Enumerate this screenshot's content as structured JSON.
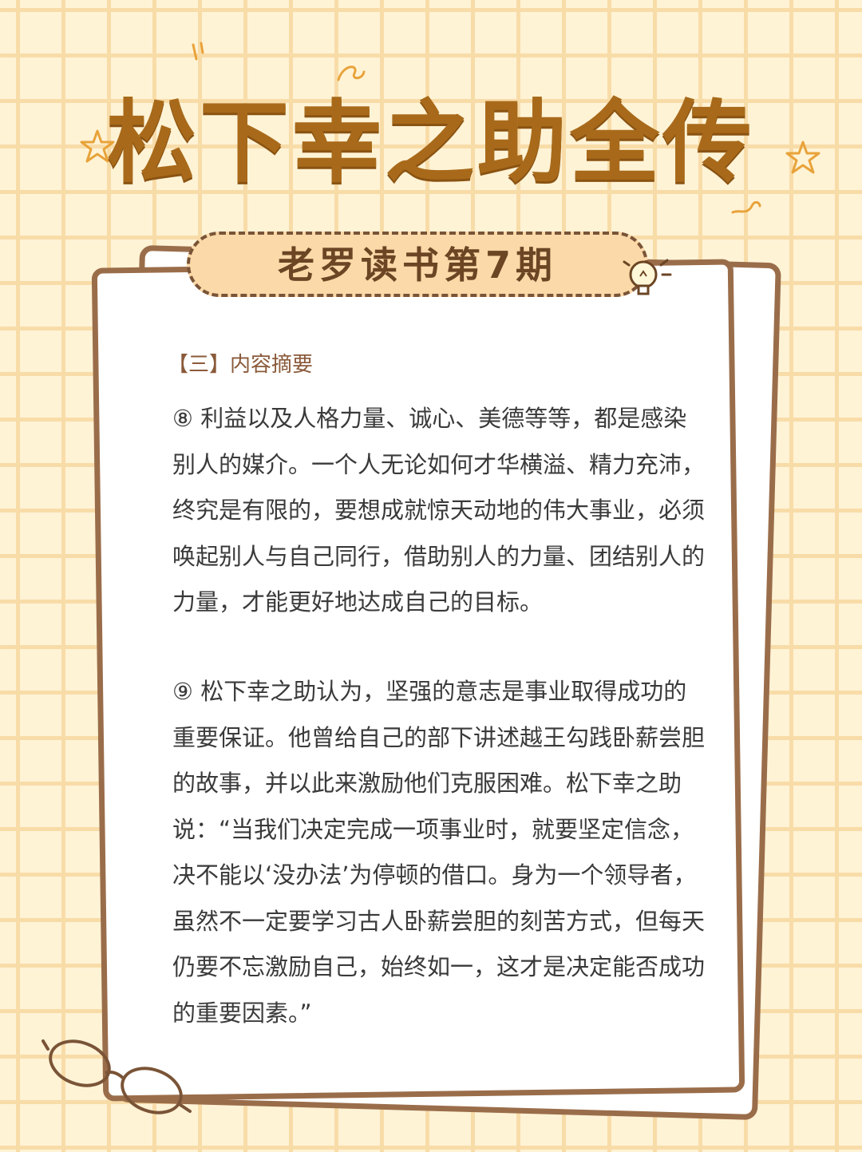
{
  "header": {
    "title": "松下幸之助全传",
    "subtitle": "老罗读书第7期"
  },
  "content": {
    "section_title": "【三】内容摘要",
    "paragraphs": [
      "⑧ 利益以及人格力量、诚心、美德等等，都是感染别人的媒介。一个人无论如何才华横溢、精力充沛，终究是有限的，要想成就惊天动地的伟大事业，必须唤起别人与自己同行，借助别人的力量、团结别人的力量，才能更好地达成自己的目标。",
      "⑨ 松下幸之助认为，坚强的意志是事业取得成功的重要保证。他曾给自己的部下讲述越王勾践卧薪尝胆的故事，并以此来激励他们克服困难。松下幸之助说：“当我们决定完成一项事业时，就要坚定信念，决不能以‘没办法’为停顿的借口。身为一个领导者，虽然不一定要学习古人卧薪尝胆的刻苦方式，但每天仍要不忘激励自己，始终如一，这才是决定能否成功的重要因素。”"
    ]
  },
  "colors": {
    "background": "#fff3d6",
    "grid": "#f8dca8",
    "title": "#a86a1a",
    "pill_fill": "#fbd9a8",
    "frame": "#9a6d4a",
    "body_text": "#3a3a3a"
  },
  "icons": [
    "star-icon",
    "star-icon",
    "squiggle-icon",
    "lightbulb-icon",
    "glasses-icon"
  ]
}
